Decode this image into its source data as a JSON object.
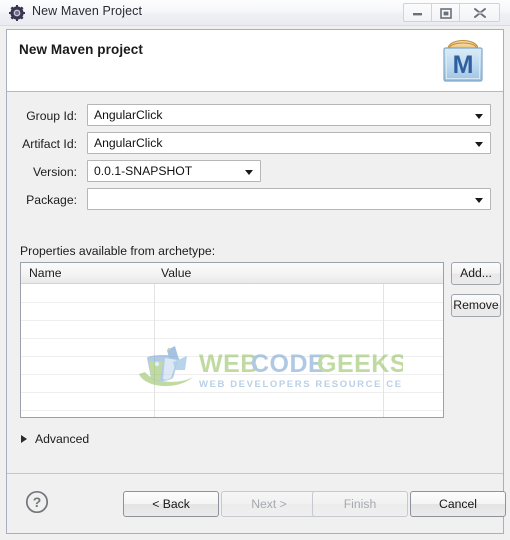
{
  "window": {
    "title": "New Maven Project",
    "title_icon": "maven-gear-icon",
    "controls": {
      "minimize": "minimize-icon",
      "maximize": "restore-icon",
      "close": "close-icon"
    }
  },
  "banner": {
    "heading": "New Maven project",
    "icon": "maven-project-icon"
  },
  "form": {
    "fields": [
      {
        "label": "Group Id:",
        "value": "AngularClick",
        "placeholder": "",
        "name": "group-id"
      },
      {
        "label": "Artifact Id:",
        "value": "AngularClick",
        "placeholder": "",
        "name": "artifact-id"
      },
      {
        "label": "Version:",
        "value": "0.0.1-SNAPSHOT",
        "placeholder": "",
        "name": "version"
      },
      {
        "label": "Package:",
        "value": "",
        "placeholder": "",
        "name": "package"
      }
    ]
  },
  "properties": {
    "label": "Properties available from archetype:",
    "columns": [
      "Name",
      "Value"
    ],
    "rows": [],
    "buttons": {
      "add": "Add...",
      "remove": "Remove"
    }
  },
  "advanced": {
    "label": "Advanced",
    "expanded": false
  },
  "footer": {
    "help": "help-icon",
    "buttons": [
      {
        "label": "< Back",
        "enabled": true,
        "name": "back-button"
      },
      {
        "label": "Next >",
        "enabled": false,
        "name": "next-button"
      },
      {
        "label": "Finish",
        "enabled": false,
        "name": "finish-button"
      },
      {
        "label": "Cancel",
        "enabled": true,
        "name": "cancel-button"
      }
    ]
  },
  "watermark": {
    "primary": "WEB CODE GEEKS",
    "tagline": "WEB DEVELOPERS RESOURCE CENTER",
    "colors": {
      "green": "#8cbf5e",
      "blue": "#7fa9d4",
      "logo_green": "#9ac46a",
      "logo_blue": "#6f9fcf"
    }
  },
  "colors": {
    "dialog_background": "#f0f0f0",
    "banner_background": "#ffffff",
    "accent_maven_blue": "#2f5f9e",
    "accent_maven_lid": "#e8b96a"
  }
}
